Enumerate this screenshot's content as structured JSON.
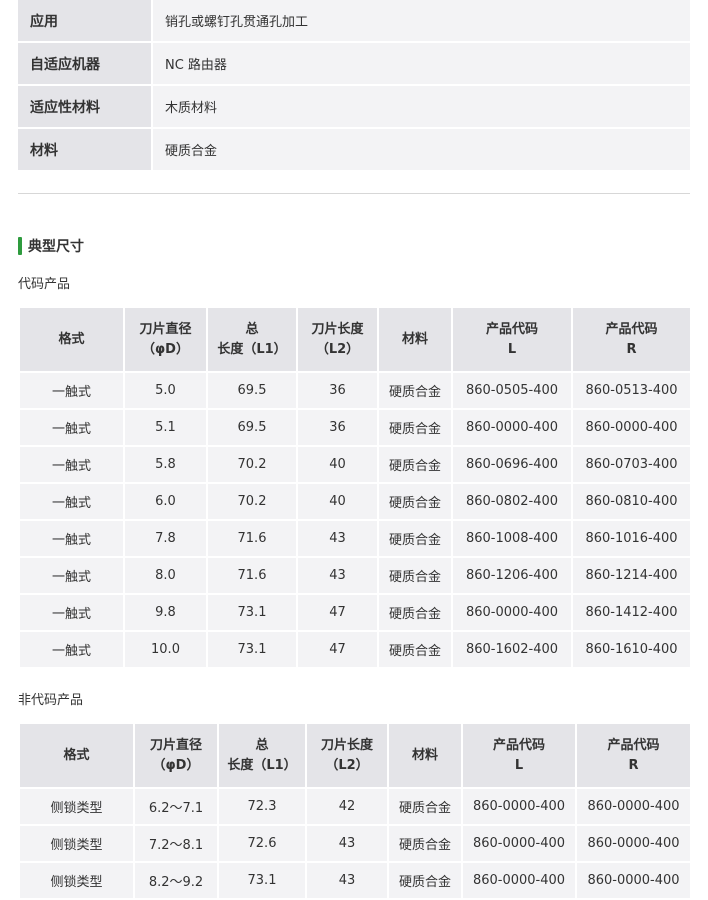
{
  "spec": [
    {
      "key": "应用",
      "value": "销孔或螺钉孔贯通孔加工"
    },
    {
      "key": "自适应机器",
      "value": "NC 路由器"
    },
    {
      "key": "适应性材料",
      "value": "木质材料"
    },
    {
      "key": "材料",
      "value": "硬质合金"
    }
  ],
  "section_title": "典型尺寸",
  "coded": {
    "subtitle": "代码产品",
    "headers": [
      [
        "格式"
      ],
      [
        "刀片直径",
        "（φD）"
      ],
      [
        "总",
        "长度（L1）"
      ],
      [
        "刀片长度",
        "（L2）"
      ],
      [
        "材料"
      ],
      [
        "产品代码",
        "L"
      ],
      [
        "产品代码",
        "R"
      ]
    ],
    "rows": [
      [
        "一触式",
        "5.0",
        "69.5",
        "36",
        "硬质合金",
        "860-0505-400",
        "860-0513-400"
      ],
      [
        "一触式",
        "5.1",
        "69.5",
        "36",
        "硬质合金",
        "860-0000-400",
        "860-0000-400"
      ],
      [
        "一触式",
        "5.8",
        "70.2",
        "40",
        "硬质合金",
        "860-0696-400",
        "860-0703-400"
      ],
      [
        "一触式",
        "6.0",
        "70.2",
        "40",
        "硬质合金",
        "860-0802-400",
        "860-0810-400"
      ],
      [
        "一触式",
        "7.8",
        "71.6",
        "43",
        "硬质合金",
        "860-1008-400",
        "860-1016-400"
      ],
      [
        "一触式",
        "8.0",
        "71.6",
        "43",
        "硬质合金",
        "860-1206-400",
        "860-1214-400"
      ],
      [
        "一触式",
        "9.8",
        "73.1",
        "47",
        "硬质合金",
        "860-0000-400",
        "860-1412-400"
      ],
      [
        "一触式",
        "10.0",
        "73.1",
        "47",
        "硬质合金",
        "860-1602-400",
        "860-1610-400"
      ]
    ]
  },
  "noncoded": {
    "subtitle": "非代码产品",
    "headers": [
      [
        "格式"
      ],
      [
        "刀片直径",
        "（φD）"
      ],
      [
        "总",
        "长度（L1）"
      ],
      [
        "刀片长度",
        "（L2）"
      ],
      [
        "材料"
      ],
      [
        "产品代码",
        "L"
      ],
      [
        "产品代码",
        "R"
      ]
    ],
    "rows": [
      [
        "侧锁类型",
        "6.2～7.1",
        "72.3",
        "42",
        "硬质合金",
        "860-0000-400",
        "860-0000-400"
      ],
      [
        "侧锁类型",
        "7.2～8.1",
        "72.6",
        "43",
        "硬质合金",
        "860-0000-400",
        "860-0000-400"
      ],
      [
        "侧锁类型",
        "8.2～9.2",
        "73.1",
        "43",
        "硬质合金",
        "860-0000-400",
        "860-0000-400"
      ]
    ]
  }
}
